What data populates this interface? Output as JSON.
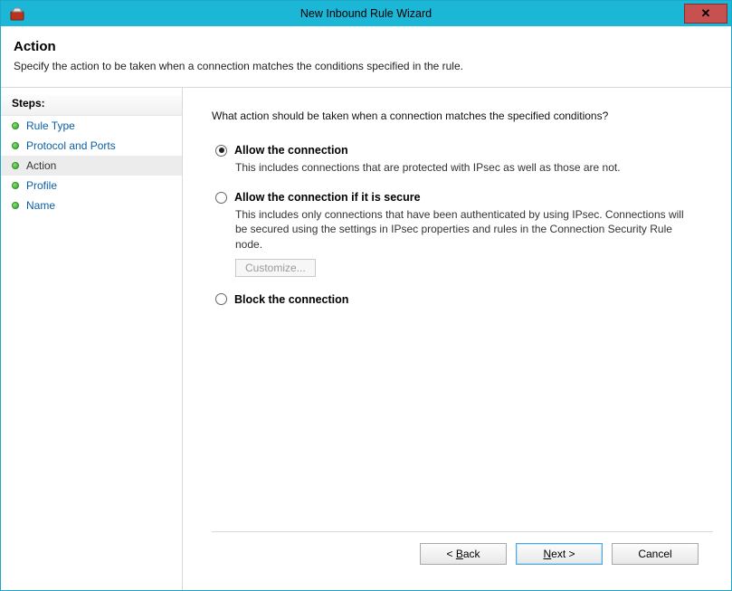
{
  "title": "New Inbound Rule Wizard",
  "header": {
    "heading": "Action",
    "subtext": "Specify the action to be taken when a connection matches the conditions specified in the rule."
  },
  "sidebar": {
    "steps_label": "Steps:",
    "items": [
      {
        "label": "Rule Type",
        "active": false
      },
      {
        "label": "Protocol and Ports",
        "active": false
      },
      {
        "label": "Action",
        "active": true
      },
      {
        "label": "Profile",
        "active": false
      },
      {
        "label": "Name",
        "active": false
      }
    ]
  },
  "main": {
    "prompt": "What action should be taken when a connection matches the specified conditions?",
    "options": [
      {
        "key": "allow",
        "label": "Allow the connection",
        "desc": "This includes connections that are protected with IPsec as well as those are not.",
        "checked": true
      },
      {
        "key": "allow-secure",
        "label": "Allow the connection if it is secure",
        "desc": "This includes only connections that have been authenticated by using IPsec. Connections will be secured using the settings in IPsec properties and rules in the Connection Security Rule node.",
        "checked": false,
        "customize_label": "Customize..."
      },
      {
        "key": "block",
        "label": "Block the connection",
        "desc": "",
        "checked": false
      }
    ]
  },
  "footer": {
    "back": "< Back",
    "next": "Next >",
    "cancel": "Cancel"
  }
}
